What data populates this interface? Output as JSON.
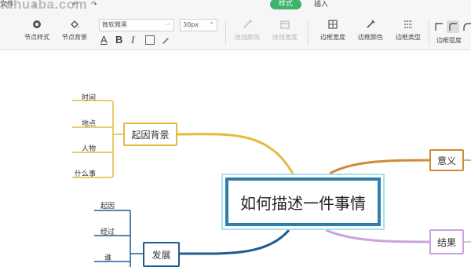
{
  "watermark": "tuhuaba.com",
  "menu": {
    "file": "文件",
    "style": "样式",
    "insert": "插入"
  },
  "toolbar": {
    "node_style": "节点样式",
    "node_bg": "节点背景",
    "font_family": "微软雅黑",
    "font_size": "30px",
    "dropdown_glyph": "···",
    "size_dropdown_glyph": "⌃",
    "bold_label": "B",
    "italic_label": "I",
    "underline_label": "A",
    "line_color": "连线颜色",
    "line_width": "连线宽度",
    "border_width": "边框宽度",
    "border_color": "边框颜色",
    "border_type": "边框类型",
    "border_radius": "边框弧度"
  },
  "mindmap": {
    "root": "如何描述一件事情",
    "branches": {
      "background": {
        "label": "起因背景",
        "color": "#e5ba3d",
        "children": [
          "时间",
          "地点",
          "人物",
          "什么事"
        ]
      },
      "development": {
        "label": "发展",
        "color": "#1f5c92",
        "children": [
          "起因",
          "经过",
          "谁"
        ]
      },
      "meaning": {
        "label": "意义",
        "color": "#cf8a37"
      },
      "result": {
        "label": "结果",
        "color": "#c9a2de"
      }
    }
  },
  "colors": {
    "accent_green": "#3db36b",
    "root_border": "#2f7eab",
    "root_outer": "#a9dff2"
  }
}
